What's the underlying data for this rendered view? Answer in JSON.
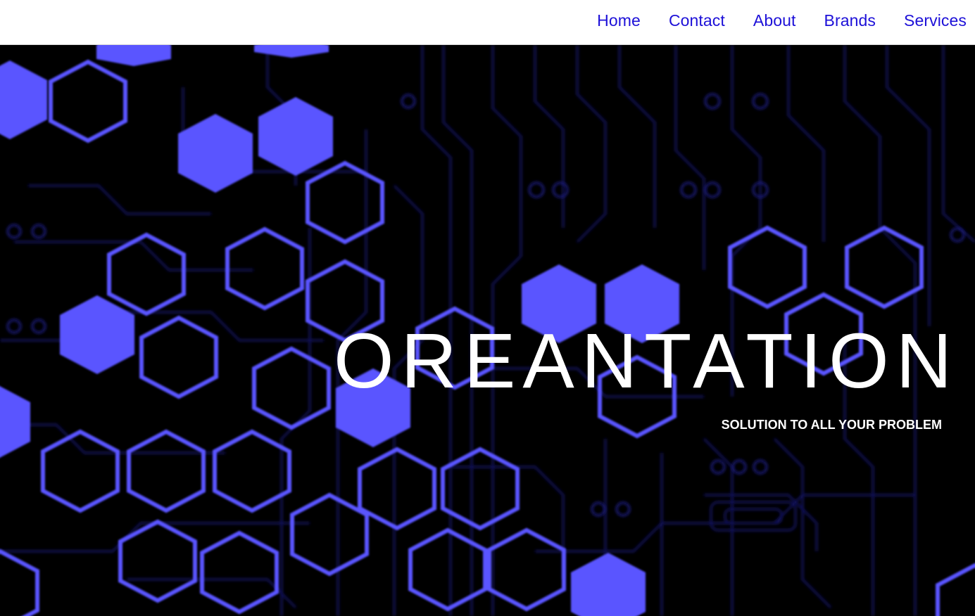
{
  "nav": {
    "items": [
      {
        "label": "Home"
      },
      {
        "label": "Contact"
      },
      {
        "label": "About"
      },
      {
        "label": "Brands"
      },
      {
        "label": "Services"
      }
    ]
  },
  "hero": {
    "title": "OREANTATION",
    "subtitle": "SOLUTION TO ALL YOUR PROBLEM"
  },
  "colors": {
    "nav_link": "#1d10d8",
    "hex_accent": "#5a55ff",
    "hero_background": "#000000"
  }
}
